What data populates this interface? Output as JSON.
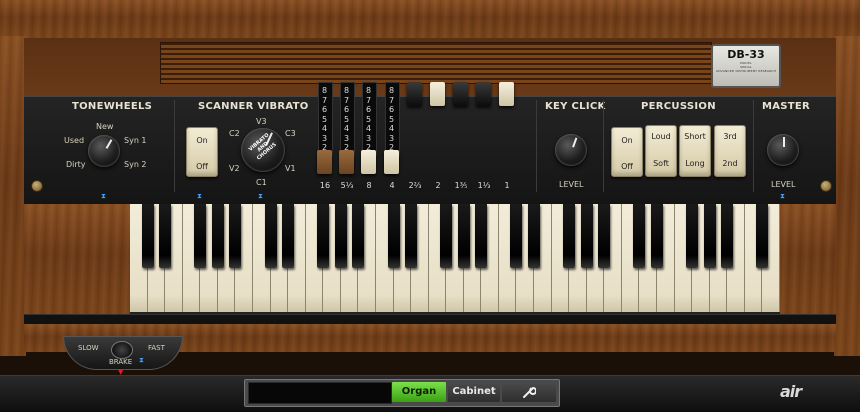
{
  "nameplate": {
    "model": "DB-33",
    "fine1": "MODEL",
    "fine2": "SERIAL",
    "fine3": "ADVANCED INSTRUMENT RESEARCH"
  },
  "tonewheels": {
    "title": "TONEWHEELS",
    "new": "New",
    "used": "Used",
    "dirty": "Dirty",
    "syn1": "Syn 1",
    "syn2": "Syn 2"
  },
  "vibrato": {
    "title": "SCANNER VIBRATO",
    "on": "On",
    "off": "Off",
    "c1": "C1",
    "c2": "C2",
    "c3": "C3",
    "v1": "V1",
    "v2": "V2",
    "v3": "V3",
    "knob_text": "VIBRATO AND CHORUS"
  },
  "drawbars": {
    "scale": [
      "8",
      "7",
      "6",
      "5",
      "4",
      "3",
      "2",
      "1"
    ],
    "footages": [
      "16",
      "5⅓",
      "8",
      "4",
      "2⅔",
      "2",
      "1⅗",
      "1⅓",
      "1"
    ],
    "settings": [
      8,
      8,
      8,
      8,
      0,
      0,
      0,
      0,
      0
    ]
  },
  "keyclick": {
    "title": "KEY CLICK",
    "level": "LEVEL"
  },
  "percussion": {
    "title": "PERCUSSION",
    "on": "On",
    "off": "Off",
    "loud": "Loud",
    "soft": "Soft",
    "short": "Short",
    "long": "Long",
    "third": "3rd",
    "second": "2nd"
  },
  "master": {
    "title": "MASTER",
    "level": "LEVEL"
  },
  "leslie": {
    "slow": "SLOW",
    "fast": "FAST",
    "brake": "BRAKE"
  },
  "bottombar": {
    "preset_value": "",
    "organ_tab": "Organ",
    "cabinet_tab": "Cabinet",
    "brand": "air"
  },
  "colors": {
    "accent_green": "#5ccc2c",
    "marker_blue": "#3fa0ff"
  }
}
